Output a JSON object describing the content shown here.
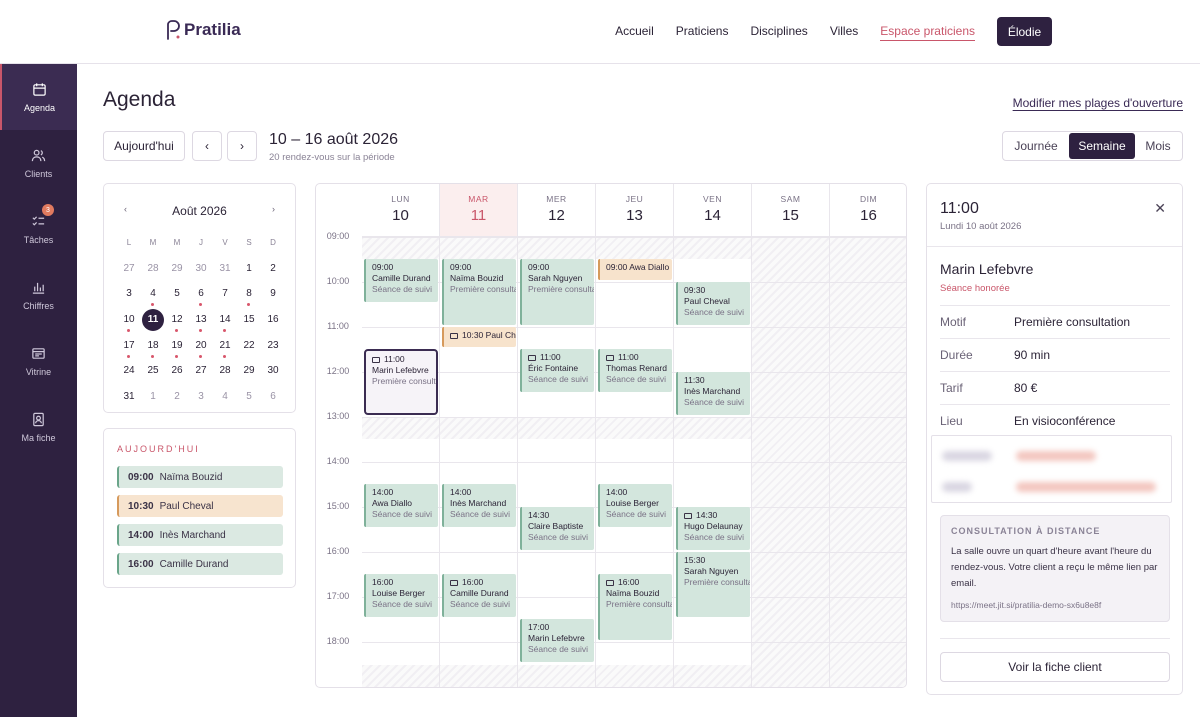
{
  "brand": {
    "name": "Pratilia"
  },
  "nav": {
    "items": [
      "Accueil",
      "Praticiens",
      "Disciplines",
      "Villes",
      "Espace praticiens"
    ],
    "user": "Élodie"
  },
  "sidebar": {
    "items": [
      {
        "label": "Agenda",
        "icon": "calendar-icon"
      },
      {
        "label": "Clients",
        "icon": "users-icon"
      },
      {
        "label": "Tâches",
        "icon": "tasks-icon",
        "badge": "3"
      },
      {
        "label": "Chiffres",
        "icon": "bar-chart-icon"
      },
      {
        "label": "Vitrine",
        "icon": "storefront-icon"
      },
      {
        "label": "Ma fiche",
        "icon": "profile-card-icon"
      }
    ]
  },
  "page": {
    "title": "Agenda",
    "modify_link": "Modifier mes plages d'ouverture"
  },
  "toolbar": {
    "today": "Aujourd'hui",
    "prev": "‹",
    "next": "›",
    "range": "10 – 16 août 2026",
    "range_sub": "20 rendez-vous sur la période",
    "views": [
      "Journée",
      "Semaine",
      "Mois"
    ],
    "selected_view": "Semaine"
  },
  "mini_calendar": {
    "month": "Août 2026",
    "dow": [
      "L",
      "M",
      "M",
      "J",
      "V",
      "S",
      "D"
    ],
    "weeks": [
      [
        "27",
        "28",
        "29",
        "30",
        "31",
        "1",
        "2"
      ],
      [
        "3",
        "4",
        "5",
        "6",
        "7",
        "8",
        "9"
      ],
      [
        "10",
        "11",
        "12",
        "13",
        "14",
        "15",
        "16"
      ],
      [
        "17",
        "18",
        "19",
        "20",
        "21",
        "22",
        "23"
      ],
      [
        "24",
        "25",
        "26",
        "27",
        "28",
        "29",
        "30"
      ],
      [
        "31",
        "1",
        "2",
        "3",
        "4",
        "5",
        "6"
      ]
    ]
  },
  "today_panel": {
    "title": "AUJOURD'HUI",
    "items": [
      {
        "time": "09:00",
        "name": "Naïma Bouzid"
      },
      {
        "time": "10:30",
        "name": "Paul Cheval"
      },
      {
        "time": "14:00",
        "name": "Inès Marchand"
      },
      {
        "time": "16:00",
        "name": "Camille Durand"
      }
    ]
  },
  "week": {
    "days": [
      {
        "dn": "LUN",
        "dd": "10"
      },
      {
        "dn": "MAR",
        "dd": "11"
      },
      {
        "dn": "MER",
        "dd": "12"
      },
      {
        "dn": "JEU",
        "dd": "13"
      },
      {
        "dn": "VEN",
        "dd": "14"
      },
      {
        "dn": "SAM",
        "dd": "15"
      },
      {
        "dn": "DIM",
        "dd": "16"
      }
    ],
    "hours": [
      "09:00",
      "10:00",
      "11:00",
      "12:00",
      "13:00",
      "14:00",
      "15:00",
      "16:00",
      "17:00",
      "18:00"
    ],
    "events": [
      {
        "day": 0,
        "start": "09:00",
        "end": "10:00",
        "time": "09:00",
        "name": "Camille Durand",
        "sub": "Séance de suivi",
        "video": false,
        "color": "g"
      },
      {
        "day": 0,
        "start": "11:00",
        "end": "12:30",
        "time": "11:00",
        "name": "Marin Lefebvre",
        "sub": "Première consultation",
        "video": true,
        "color": "sel"
      },
      {
        "day": 0,
        "start": "14:00",
        "end": "15:00",
        "time": "14:00",
        "name": "Awa Diallo",
        "sub": "Séance de suivi",
        "video": false,
        "color": "g"
      },
      {
        "day": 0,
        "start": "16:00",
        "end": "17:00",
        "time": "16:00",
        "name": "Louise Berger",
        "sub": "Séance de suivi",
        "video": false,
        "color": "g"
      },
      {
        "day": 1,
        "start": "09:00",
        "end": "10:30",
        "time": "09:00",
        "name": "Naïma Bouzid",
        "sub": "Première consultation",
        "video": false,
        "color": "g"
      },
      {
        "day": 1,
        "start": "10:30",
        "end": "11:00",
        "time": "10:30",
        "name": "Paul Cheval",
        "sub": "",
        "video": true,
        "color": "o"
      },
      {
        "day": 1,
        "start": "14:00",
        "end": "15:00",
        "time": "14:00",
        "name": "Inès Marchand",
        "sub": "Séance de suivi",
        "video": false,
        "color": "g"
      },
      {
        "day": 1,
        "start": "16:00",
        "end": "17:00",
        "time": "16:00",
        "name": "Camille Durand",
        "sub": "Séance de suivi",
        "video": true,
        "color": "g"
      },
      {
        "day": 2,
        "start": "09:00",
        "end": "10:30",
        "time": "09:00",
        "name": "Sarah Nguyen",
        "sub": "Première consultation",
        "video": false,
        "color": "g"
      },
      {
        "day": 2,
        "start": "11:00",
        "end": "12:00",
        "time": "11:00",
        "name": "Éric Fontaine",
        "sub": "Séance de suivi",
        "video": true,
        "color": "g"
      },
      {
        "day": 2,
        "start": "14:30",
        "end": "15:30",
        "time": "14:30",
        "name": "Claire Baptiste",
        "sub": "Séance de suivi",
        "video": false,
        "color": "g"
      },
      {
        "day": 2,
        "start": "17:00",
        "end": "18:00",
        "time": "17:00",
        "name": "Marin Lefebvre",
        "sub": "Séance de suivi",
        "video": false,
        "color": "g"
      },
      {
        "day": 3,
        "start": "09:00",
        "end": "09:30",
        "time": "09:00",
        "name": "Awa Diallo",
        "sub": "",
        "video": false,
        "color": "o"
      },
      {
        "day": 3,
        "start": "11:00",
        "end": "12:00",
        "time": "11:00",
        "name": "Thomas Renard",
        "sub": "Séance de suivi",
        "video": true,
        "color": "g"
      },
      {
        "day": 3,
        "start": "14:00",
        "end": "15:00",
        "time": "14:00",
        "name": "Louise Berger",
        "sub": "Séance de suivi",
        "video": false,
        "color": "g"
      },
      {
        "day": 3,
        "start": "16:00",
        "end": "17:30",
        "time": "16:00",
        "name": "Naïma Bouzid",
        "sub": "Première consultation",
        "video": true,
        "color": "g"
      },
      {
        "day": 4,
        "start": "09:30",
        "end": "10:30",
        "time": "09:30",
        "name": "Paul Cheval",
        "sub": "Séance de suivi",
        "video": false,
        "color": "g"
      },
      {
        "day": 4,
        "start": "11:30",
        "end": "12:30",
        "time": "11:30",
        "name": "Inès Marchand",
        "sub": "Séance de suivi",
        "video": false,
        "color": "g"
      },
      {
        "day": 4,
        "start": "14:30",
        "end": "15:30",
        "time": "14:30",
        "name": "Hugo Delaunay",
        "sub": "Séance de suivi",
        "video": true,
        "color": "g"
      },
      {
        "day": 4,
        "start": "15:30",
        "end": "17:00",
        "time": "15:30",
        "name": "Sarah Nguyen",
        "sub": "Première consultation",
        "video": false,
        "color": "g"
      }
    ]
  },
  "detail": {
    "time": "11:00",
    "date": "Lundi 10 août 2026",
    "close": "✕",
    "name": "Marin Lefebvre",
    "status": "Séance honorée",
    "rows": [
      {
        "k": "Motif",
        "v": "Première consultation"
      },
      {
        "k": "Durée",
        "v": "90 min"
      },
      {
        "k": "Tarif",
        "v": "80 €"
      },
      {
        "k": "Lieu",
        "v": "En visioconférence"
      }
    ],
    "remote_title": "CONSULTATION À DISTANCE",
    "remote_text": "La salle ouvre un quart d'heure avant l'heure du rendez-vous. Votre client a reçu le même lien par email.",
    "remote_link": "https://meet.jit.si/pratilia-demo-sx6u8e8f",
    "client_button": "Voir la fiche client"
  },
  "colors": {
    "primary": "#2e2140",
    "accent": "#c9566a",
    "event_green": "#d3e6dd",
    "event_orange": "#f7e3cc"
  }
}
